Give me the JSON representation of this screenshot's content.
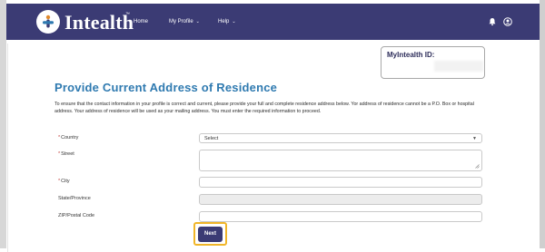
{
  "app": {
    "logo_text": "Intealth",
    "trademark": "™"
  },
  "nav": {
    "items": [
      {
        "label": "Home"
      },
      {
        "label": "My Profile"
      },
      {
        "label": "Help"
      }
    ],
    "icons": [
      "bell-icon",
      "user-icon",
      "chevron-down-icon"
    ]
  },
  "id_box": {
    "label": "MyIntealth ID:"
  },
  "page": {
    "title": "Provide Current Address of Residence",
    "description": "To ensure that the contact information in your profile is correct and current, please provide your full and complete residence address below. Yor address of residence cannot be a P.O. Box or hospital address. Your address of residence will be used as your mailing address. You must enter the required information to proceed."
  },
  "form": {
    "country": {
      "label": "Country",
      "required_mark": "*",
      "value": "Select"
    },
    "street": {
      "label": "Street",
      "required_mark": "*",
      "value": ""
    },
    "city": {
      "label": "City",
      "required_mark": "*",
      "value": ""
    },
    "state": {
      "label": "State/Province",
      "value": ""
    },
    "zip": {
      "label": "ZIP/Postal Code",
      "value": ""
    }
  },
  "actions": {
    "next_label": "Next"
  },
  "colors": {
    "header_bg": "#3b3b74",
    "title": "#2f7ab0",
    "required": "#c23934",
    "focus_outline": "#f0b528"
  }
}
